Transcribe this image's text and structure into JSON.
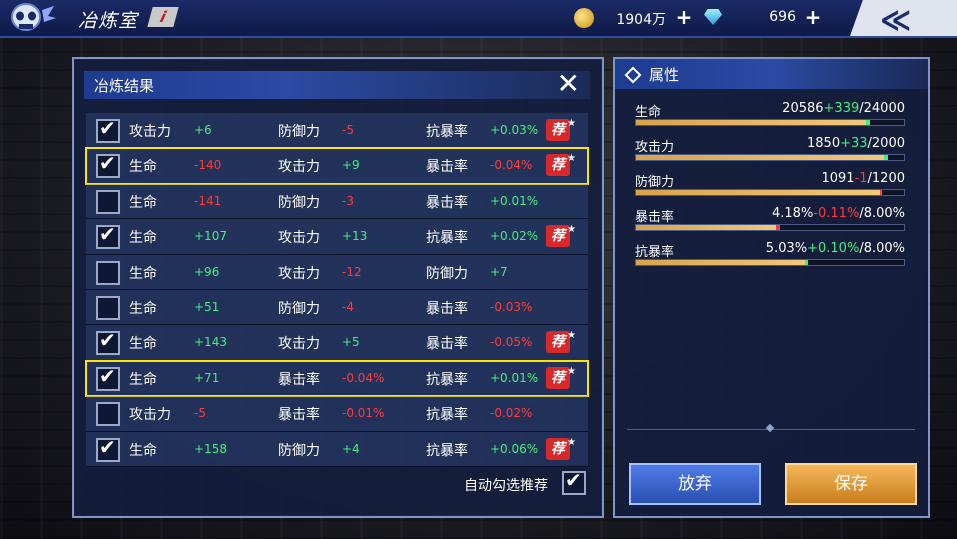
{
  "topbar": {
    "title": "冶炼室",
    "info": "i",
    "coins": "1904万",
    "gems": "696",
    "back_glyph": "≪"
  },
  "panel": {
    "title": "冶炼结果",
    "close": "✕",
    "auto_label": "自动勾选推荐",
    "rec_label": "荐",
    "rows": [
      {
        "checked": true,
        "hl": false,
        "rec": true,
        "a": [
          "攻击力",
          "+6"
        ],
        "b": [
          "防御力",
          "-5"
        ],
        "c": [
          "抗暴率",
          "+0.03%"
        ]
      },
      {
        "checked": true,
        "hl": true,
        "rec": true,
        "a": [
          "生命",
          "-140"
        ],
        "b": [
          "攻击力",
          "+9"
        ],
        "c": [
          "暴击率",
          "-0.04%"
        ]
      },
      {
        "checked": false,
        "hl": false,
        "rec": false,
        "a": [
          "生命",
          "-141"
        ],
        "b": [
          "防御力",
          "-3"
        ],
        "c": [
          "暴击率",
          "+0.01%"
        ]
      },
      {
        "checked": true,
        "hl": false,
        "rec": true,
        "a": [
          "生命",
          "+107"
        ],
        "b": [
          "攻击力",
          "+13"
        ],
        "c": [
          "抗暴率",
          "+0.02%"
        ]
      },
      {
        "checked": false,
        "hl": false,
        "rec": false,
        "a": [
          "生命",
          "+96"
        ],
        "b": [
          "攻击力",
          "-12"
        ],
        "c": [
          "防御力",
          "+7"
        ]
      },
      {
        "checked": false,
        "hl": false,
        "rec": false,
        "a": [
          "生命",
          "+51"
        ],
        "b": [
          "防御力",
          "-4"
        ],
        "c": [
          "暴击率",
          "-0.03%"
        ]
      },
      {
        "checked": true,
        "hl": false,
        "rec": true,
        "a": [
          "生命",
          "+143"
        ],
        "b": [
          "攻击力",
          "+5"
        ],
        "c": [
          "暴击率",
          "-0.05%"
        ]
      },
      {
        "checked": true,
        "hl": true,
        "rec": true,
        "a": [
          "生命",
          "+71"
        ],
        "b": [
          "暴击率",
          "-0.04%"
        ],
        "c": [
          "抗暴率",
          "+0.01%"
        ]
      },
      {
        "checked": false,
        "hl": false,
        "rec": false,
        "a": [
          "攻击力",
          "-5"
        ],
        "b": [
          "暴击率",
          "-0.01%"
        ],
        "c": [
          "抗暴率",
          "-0.02%"
        ]
      },
      {
        "checked": true,
        "hl": false,
        "rec": true,
        "a": [
          "生命",
          "+158"
        ],
        "b": [
          "防御力",
          "+4"
        ],
        "c": [
          "抗暴率",
          "+0.06%"
        ]
      }
    ]
  },
  "attrs": {
    "title": "属性",
    "items": [
      {
        "name": "生命",
        "base": "20586",
        "delta": "+339",
        "max": "/24000",
        "sign": "p",
        "fill": 0.8578,
        "change": 0.0141
      },
      {
        "name": "攻击力",
        "base": "1850",
        "delta": "+33",
        "max": "/2000",
        "sign": "p",
        "fill": 0.925,
        "change": 0.0165
      },
      {
        "name": "防御力",
        "base": "1091",
        "delta": "-1",
        "max": "/1200",
        "sign": "m",
        "fill": 0.9092,
        "change": 0.0008
      },
      {
        "name": "暴击率",
        "base": "4.18%",
        "delta": "-0.11%",
        "max": "/8.00%",
        "sign": "m",
        "fill": 0.5225,
        "change": 0.0138
      },
      {
        "name": "抗暴率",
        "base": "5.03%",
        "delta": "+0.10%",
        "max": "/8.00%",
        "sign": "p",
        "fill": 0.6288,
        "change": 0.0125
      }
    ]
  },
  "buttons": {
    "abandon": "放弃",
    "save": "保存"
  }
}
